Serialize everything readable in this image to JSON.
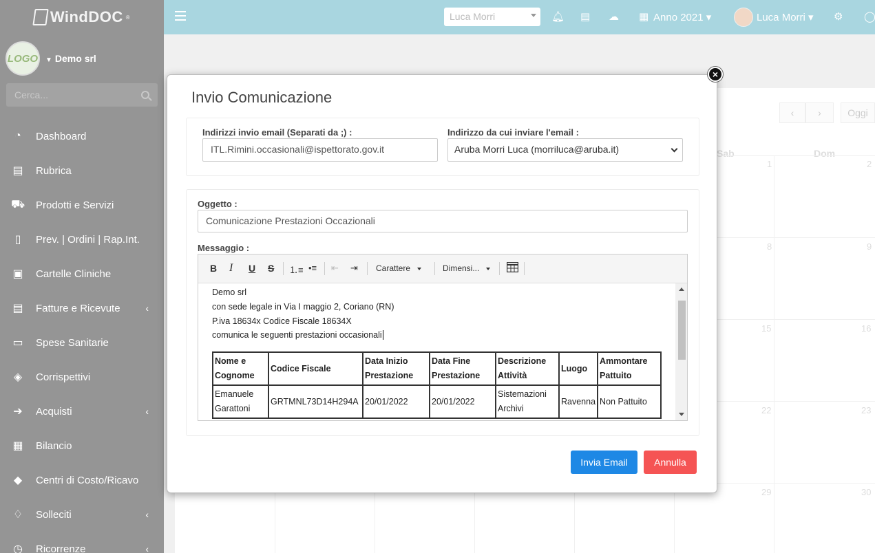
{
  "brand": {
    "name": "WindDOC",
    "reg": "®"
  },
  "company": {
    "name": "Demo srl",
    "logo_text": "LOGO"
  },
  "sidebar": {
    "search_placeholder": "Cerca...",
    "items": [
      {
        "label": "Dashboard",
        "icon": "dashboard-icon",
        "glyph": "◔",
        "has_arrow": false
      },
      {
        "label": "Rubrica",
        "icon": "book-icon",
        "glyph": "▤",
        "has_arrow": false
      },
      {
        "label": "Prodotti e Servizi",
        "icon": "cart-icon",
        "glyph": "⛟",
        "has_arrow": false
      },
      {
        "label": "Prev. | Ordini | Rap.Int.",
        "icon": "file-icon",
        "glyph": "▯",
        "has_arrow": false
      },
      {
        "label": "Cartelle Cliniche",
        "icon": "calendar-plus-icon",
        "glyph": "▣",
        "has_arrow": false
      },
      {
        "label": "Fatture e Ricevute",
        "icon": "invoice-icon",
        "glyph": "▤",
        "has_arrow": true
      },
      {
        "label": "Spese Sanitarie",
        "icon": "id-card-icon",
        "glyph": "▭",
        "has_arrow": false
      },
      {
        "label": "Corrispettivi",
        "icon": "ticket-icon",
        "glyph": "◈",
        "has_arrow": false
      },
      {
        "label": "Acquisti",
        "icon": "sign-in-icon",
        "glyph": "➔",
        "has_arrow": true
      },
      {
        "label": "Bilancio",
        "icon": "calculator-icon",
        "glyph": "▦",
        "has_arrow": false
      },
      {
        "label": "Centri di Costo/Ricavo",
        "icon": "tags-icon",
        "glyph": "◆",
        "has_arrow": false
      },
      {
        "label": "Solleciti",
        "icon": "bell-icon",
        "glyph": "♢",
        "has_arrow": true
      },
      {
        "label": "Ricorrenze",
        "icon": "clock-icon",
        "glyph": "◷",
        "has_arrow": true
      }
    ],
    "arrow_glyph": "‹"
  },
  "topbar": {
    "user_select_value": "Luca Morri",
    "year_label": "Anno 2021",
    "user_name": "Luca Morri"
  },
  "calendar": {
    "today_label": "Oggi",
    "prev_glyph": "‹",
    "next_glyph": "›",
    "weekdays": [
      "Sab",
      "Dom"
    ],
    "days": [
      "1",
      "2",
      "8",
      "9",
      "15",
      "16",
      "22",
      "23",
      "29",
      "30"
    ]
  },
  "modal": {
    "title": "Invio Comunicazione",
    "close_glyph": "×",
    "email_to_label": "Indirizzi invio email (Separati da ;) :",
    "email_to_value": "ITL.Rimini.occasionali@ispettorato.gov.it",
    "email_from_label": "Indirizzo da cui inviare l'email :",
    "email_from_value": "Aruba Morri Luca (morriluca@aruba.it)",
    "subject_label": "Oggetto :",
    "subject_value": "Comunicazione Prestazioni Occazionali",
    "message_label": "Messaggio :",
    "toolbar": {
      "bold": "B",
      "italic": "I",
      "underline": "U",
      "strike": "S",
      "font_label": "Carattere",
      "size_label": "Dimensi..."
    },
    "message_lines": [
      "Demo srl",
      "con sede legale in Via I maggio 2, Coriano (RN)",
      "P.iva 18634x Codice Fiscale 18634X",
      "comunica le seguenti prestazioni occasionali"
    ],
    "table": {
      "headers": [
        [
          "Nome e",
          "Cognome"
        ],
        [
          "Codice Fiscale"
        ],
        [
          "Data Inizio",
          "Prestazione"
        ],
        [
          "Data Fine",
          "Prestazione"
        ],
        [
          "Descrizione",
          "Attività"
        ],
        [
          "Luogo"
        ],
        [
          "Ammontare",
          "Pattuito"
        ]
      ],
      "rows": [
        [
          [
            "Emanuele",
            "Garattoni"
          ],
          [
            "GRTMNL73D14H294A"
          ],
          [
            "20/01/2022"
          ],
          [
            "20/01/2022"
          ],
          [
            "Sistemazioni",
            "Archivi"
          ],
          [
            "Ravenna"
          ],
          [
            "Non Pattuito"
          ]
        ]
      ]
    },
    "send_label": "Invia Email",
    "cancel_label": "Annulla"
  },
  "colors": {
    "sidebar": "#959595",
    "topbar": "#a9d6e0",
    "primary": "#1e88e5",
    "danger": "#f55454"
  }
}
